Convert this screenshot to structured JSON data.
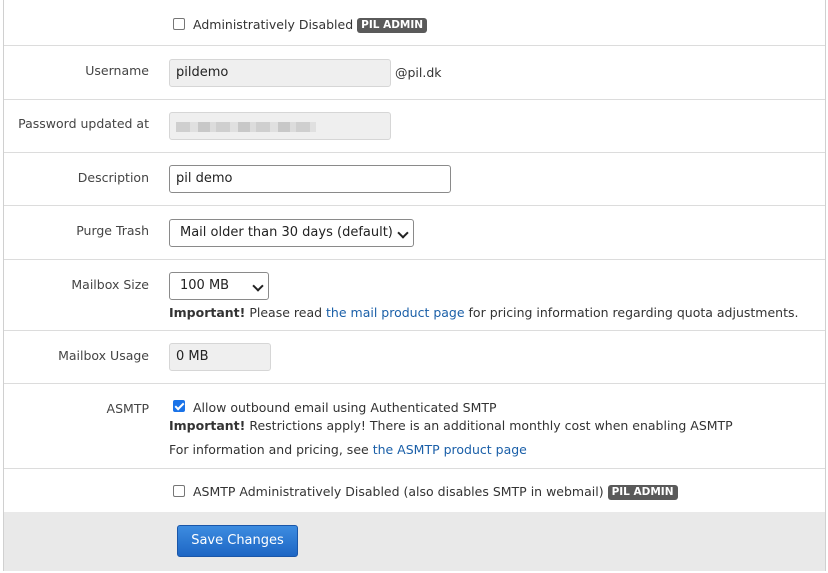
{
  "admin_disabled": {
    "label": "Administratively Disabled",
    "badge": "PIL ADMIN",
    "checked": false
  },
  "username": {
    "label": "Username",
    "value": "pildemo",
    "domain": "@pil.dk"
  },
  "password_updated": {
    "label": "Password updated at"
  },
  "description": {
    "label": "Description",
    "value": "pil demo"
  },
  "purge_trash": {
    "label": "Purge Trash",
    "selected": "Mail older than 30 days (default)"
  },
  "mailbox_size": {
    "label": "Mailbox Size",
    "selected": "100 MB",
    "note_bold": "Important!",
    "note_pre": "Please read",
    "note_link": "the mail product page",
    "note_post": "for pricing information regarding quota adjustments."
  },
  "mailbox_usage": {
    "label": "Mailbox Usage",
    "value": "0 MB"
  },
  "asmtp": {
    "label": "ASMTP",
    "checkbox_label": "Allow outbound email using Authenticated SMTP",
    "checked": true,
    "note_bold": "Important!",
    "note_text": "Restrictions apply! There is an additional monthly cost when enabling ASMTP",
    "info_pre": "For information and pricing, see",
    "info_link": "the ASMTP product page"
  },
  "asmtp_admin_disabled": {
    "label": "ASMTP Administratively Disabled (also disables SMTP in webmail)",
    "badge": "PIL ADMIN",
    "checked": false
  },
  "footer": {
    "save_label": "Save Changes"
  },
  "colors": {
    "link": "#1a5fa8",
    "button": "#2a76d2",
    "badge": "#5a5a5a",
    "footer": "#e9e9e9"
  }
}
